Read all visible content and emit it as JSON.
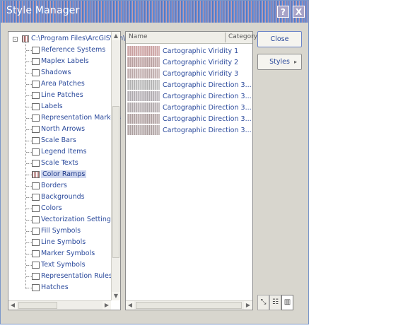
{
  "window": {
    "title": "Style Manager",
    "help_button": "?",
    "close_button": "X"
  },
  "tree": {
    "root_label": "C:\\Program Files\\ArcGIS\\Bin\\Styles\\ESRI.style",
    "root_expander": "-",
    "items": [
      {
        "label": "Reference Systems"
      },
      {
        "label": "Maplex Labels"
      },
      {
        "label": "Shadows"
      },
      {
        "label": "Area Patches"
      },
      {
        "label": "Line Patches"
      },
      {
        "label": "Labels"
      },
      {
        "label": "Representation Markers"
      },
      {
        "label": "North Arrows"
      },
      {
        "label": "Scale Bars"
      },
      {
        "label": "Legend Items"
      },
      {
        "label": "Scale Texts"
      },
      {
        "label": "Color Ramps",
        "selected": true
      },
      {
        "label": "Borders"
      },
      {
        "label": "Backgrounds"
      },
      {
        "label": "Colors"
      },
      {
        "label": "Vectorization Settings"
      },
      {
        "label": "Fill Symbols"
      },
      {
        "label": "Line Symbols"
      },
      {
        "label": "Marker Symbols"
      },
      {
        "label": "Text Symbols"
      },
      {
        "label": "Representation Rules"
      },
      {
        "label": "Hatches"
      }
    ]
  },
  "list": {
    "columns": [
      "Name",
      "Category"
    ],
    "items": [
      {
        "name": "Cartographic Viridity 1",
        "swatch": [
          "#d9b6b6",
          "#c8a0a0",
          "#e6d2d2"
        ]
      },
      {
        "name": "Cartographic Viridity 2",
        "swatch": [
          "#cdb6b6",
          "#b6a0a0",
          "#e0d0d0"
        ]
      },
      {
        "name": "Cartographic Viridity 3",
        "swatch": [
          "#d0c0c0",
          "#b9a8a8",
          "#e4dada"
        ]
      },
      {
        "name": "Cartographic Direction 3...",
        "swatch": [
          "#c9c9c9",
          "#b0b0b0",
          "#e0e0e0"
        ]
      },
      {
        "name": "Cartographic Direction 3...",
        "swatch": [
          "#c8c4c8",
          "#ada9ad",
          "#dcd8dc"
        ]
      },
      {
        "name": "Cartographic Direction 3...",
        "swatch": [
          "#c6c0c2",
          "#aea8aa",
          "#dcd6d8"
        ]
      },
      {
        "name": "Cartographic Direction 3...",
        "swatch": [
          "#c6bcbc",
          "#ad9f9f",
          "#dcd2d2"
        ]
      },
      {
        "name": "Cartographic Direction 3...",
        "swatch": [
          "#c8c0c0",
          "#ab9f9f",
          "#ddd5d5"
        ]
      }
    ]
  },
  "buttons": {
    "close": "Close",
    "styles": "Styles",
    "styles_arrow": "▸"
  },
  "view_buttons": [
    {
      "icon": "large-icons-icon",
      "glyph": "⤡"
    },
    {
      "icon": "list-icon",
      "glyph": "☷"
    },
    {
      "icon": "details-icon",
      "glyph": "▥"
    }
  ]
}
